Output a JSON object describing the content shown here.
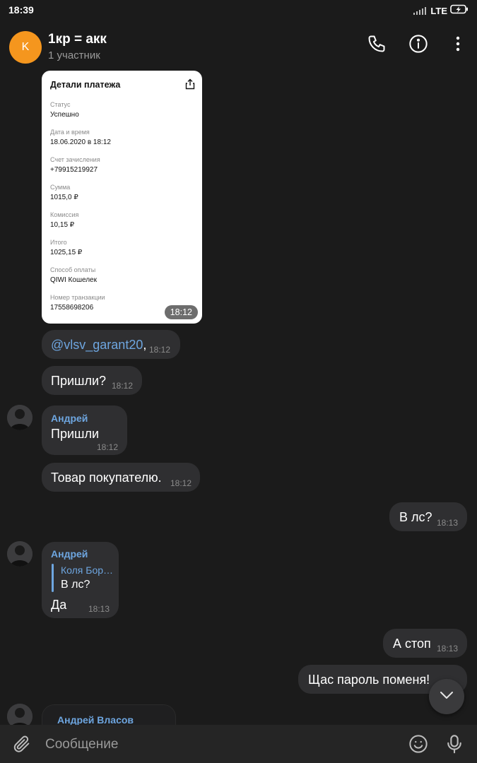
{
  "status_bar": {
    "time": "18:39",
    "network": "LTE"
  },
  "header": {
    "title": "1кр = акк",
    "subtitle": "1 участник",
    "avatar_letter": "K"
  },
  "receipt": {
    "title": "Детали платежа",
    "fields": [
      {
        "label": "Статус",
        "value": "Успешно"
      },
      {
        "label": "Дата и время",
        "value": "18.06.2020 в 18:12"
      },
      {
        "label": "Счет зачисления",
        "value": "+79915219927"
      },
      {
        "label": "Сумма",
        "value": "1015,0 ₽"
      },
      {
        "label": "Комиссия",
        "value": "10,15 ₽"
      },
      {
        "label": "Итого",
        "value": "1025,15 ₽"
      },
      {
        "label": "Способ оплаты",
        "value": "QIWI Кошелек"
      },
      {
        "label": "Номер транзакции",
        "value": "17558698206"
      }
    ],
    "time": "18:12"
  },
  "messages": [
    {
      "mention": "@vlsv_garant20",
      "text": ",",
      "time": "18:12"
    },
    {
      "text": "Пришли?",
      "time": "18:12"
    },
    {
      "sender": "Андрей",
      "text": "Пришли",
      "time": "18:12"
    },
    {
      "text": "Товар покупателю.",
      "time": "18:12"
    },
    {
      "text": "В лс?",
      "time": "18:13"
    },
    {
      "sender": "Андрей",
      "reply_to": "Коля Бор…",
      "reply_text": "В лс?",
      "text": "Да",
      "time": "18:13"
    },
    {
      "text": "А стоп",
      "time": "18:13"
    },
    {
      "text": "Щас пароль поменя!"
    },
    {
      "sender": "Андрей Власов"
    }
  ],
  "input": {
    "placeholder": "Сообщение"
  },
  "colors": {
    "accent": "#6ea6e0",
    "bubble": "#2f2f31",
    "avatar": "#f5961e",
    "background": "#1b1b1b"
  }
}
